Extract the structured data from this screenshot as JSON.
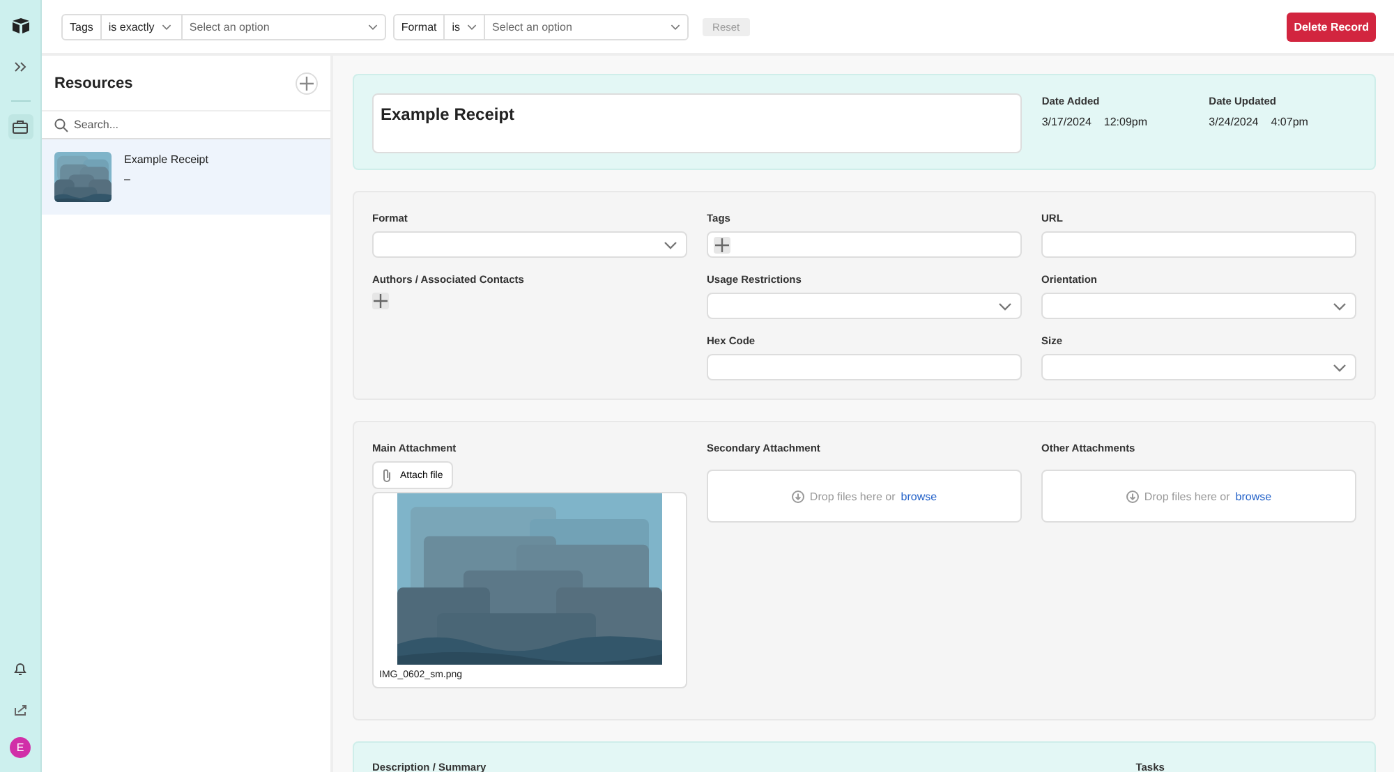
{
  "filters": [
    {
      "field": "Tags",
      "operator": "is exactly",
      "placeholder": "Select an option"
    },
    {
      "field": "Format",
      "operator": "is",
      "placeholder": "Select an option"
    }
  ],
  "reset_button": {
    "label": "Reset",
    "disabled": true
  },
  "delete_button": {
    "label": "Delete Record"
  },
  "rail": {
    "avatar": {
      "initial": "E",
      "color": "#d12fa8"
    }
  },
  "resources": {
    "title": "Resources",
    "search": {
      "placeholder": "Search..."
    },
    "items": [
      {
        "title": "Example Receipt",
        "subtitle": "–",
        "selected": true,
        "kind": "picture"
      }
    ]
  },
  "record": {
    "title": "Example Receipt",
    "meta": [
      {
        "label": "Date Added",
        "date": "3/17/2024",
        "time": "12:09pm"
      },
      {
        "label": "Date Updated",
        "date": "3/24/2024",
        "time": "4:07pm"
      }
    ]
  },
  "fields": [
    {
      "label": "Format",
      "kind": "select"
    },
    {
      "label": "Tags",
      "kind": "tags"
    },
    {
      "label": "URL",
      "kind": "text"
    },
    {
      "label": "Authors / Associated Contacts",
      "kind": "contacts"
    },
    {
      "label": "Usage Restrictions",
      "kind": "select"
    },
    {
      "label": "Orientation",
      "kind": "select"
    },
    {
      "label": "Hex Code",
      "kind": "text"
    },
    {
      "label": "Size",
      "kind": "select"
    }
  ],
  "attachments": [
    {
      "label": "Main Attachment",
      "kind": "file",
      "button": "Attach file",
      "file_name": "IMG_0602_sm.png"
    },
    {
      "label": "Secondary Attachment",
      "kind": "dropzone",
      "text": "Drop files here or",
      "link": "browse"
    },
    {
      "label": "Other Attachments",
      "kind": "dropzone",
      "text": "Drop files here or",
      "link": "browse"
    }
  ],
  "lower_section": {
    "labels": [
      "Description / Summary",
      "Tasks"
    ]
  }
}
